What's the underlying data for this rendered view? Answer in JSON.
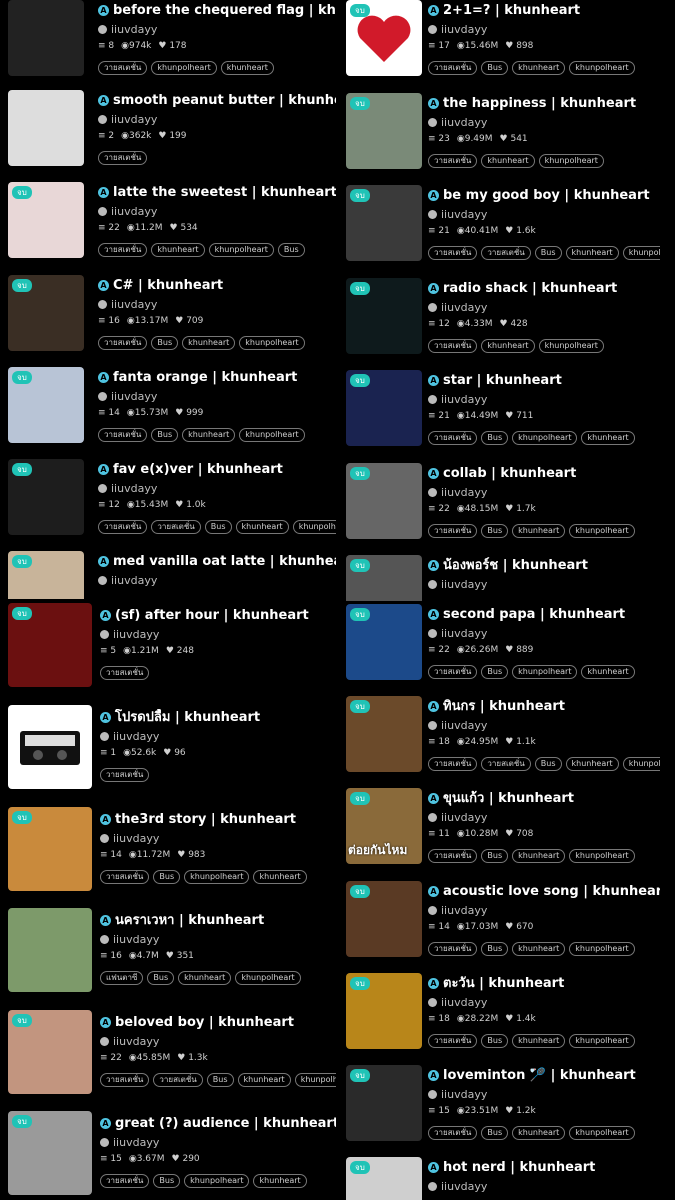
{
  "author": "iiuvdayy",
  "badge": "จบ",
  "cards": [
    {
      "id": "l0",
      "title": "before the chequered flag | khunheart",
      "stats": {
        "parts": "8",
        "reads": "974k",
        "votes": "178"
      },
      "tags": [
        "วายสเตชั่น",
        "khunpolheart",
        "khunheart"
      ],
      "thumb_color": "#222",
      "badge": false
    },
    {
      "id": "l1",
      "title": "smooth peanut butter | khunheart",
      "stats": {
        "parts": "2",
        "reads": "362k",
        "votes": "199"
      },
      "tags": [
        "วายสเตชั่น"
      ],
      "thumb_color": "#ddd",
      "badge": false
    },
    {
      "id": "l2",
      "title": "latte the sweetest | khunheart",
      "stats": {
        "parts": "22",
        "reads": "11.2M",
        "votes": "534"
      },
      "tags": [
        "วายสเตชั่น",
        "khunheart",
        "khunpolheart",
        "Bus"
      ],
      "thumb_color": "#e8d7d7",
      "badge": true
    },
    {
      "id": "l3",
      "title": "C# | khunheart",
      "stats": {
        "parts": "16",
        "reads": "13.17M",
        "votes": "709"
      },
      "tags": [
        "วายสเตชั่น",
        "Bus",
        "khunheart",
        "khunpolheart"
      ],
      "thumb_color": "#3a2e24",
      "badge": true
    },
    {
      "id": "l4",
      "title": "fanta orange | khunheart",
      "stats": {
        "parts": "14",
        "reads": "15.73M",
        "votes": "999"
      },
      "tags": [
        "วายสเตชั่น",
        "Bus",
        "khunheart",
        "khunpolheart"
      ],
      "thumb_color": "#b8c4d6",
      "badge": true
    },
    {
      "id": "l5",
      "title": "fav e(x)ver | khunheart",
      "stats": {
        "parts": "12",
        "reads": "15.43M",
        "votes": "1.0k"
      },
      "tags": [
        "วายสเตชั่น",
        "วายสเตชั่น",
        "Bus",
        "khunheart",
        "khunpolheart"
      ],
      "thumb_color": "#1d1d1d",
      "badge": true
    },
    {
      "id": "l6",
      "title": "med vanilla oat latte | khunheart",
      "stats": {
        "parts": "",
        "reads": "",
        "votes": ""
      },
      "tags": [],
      "thumb_color": "#c8b49a",
      "badge": true
    },
    {
      "id": "l7",
      "title": "(sf) after hour | khunheart",
      "stats": {
        "parts": "5",
        "reads": "1.21M",
        "votes": "248"
      },
      "tags": [
        "วายสเตชั่น"
      ],
      "thumb_color": "#6b1010",
      "badge": true
    },
    {
      "id": "l8",
      "title": "โปรดปลื้ม | khunheart",
      "stats": {
        "parts": "1",
        "reads": "52.6k",
        "votes": "96"
      },
      "tags": [
        "วายสเตชั่น"
      ],
      "thumb_color": "#fff",
      "badge": false
    },
    {
      "id": "l9",
      "title": "the3rd story | khunheart",
      "stats": {
        "parts": "14",
        "reads": "11.72M",
        "votes": "983"
      },
      "tags": [
        "วายสเตชั่น",
        "Bus",
        "khunpolheart",
        "khunheart"
      ],
      "thumb_color": "#c98a3c",
      "badge": true
    },
    {
      "id": "l10",
      "title": "นคราเวหา | khunheart",
      "stats": {
        "parts": "16",
        "reads": "4.7M",
        "votes": "351"
      },
      "tags": [
        "แฟนตาซี",
        "Bus",
        "khunheart",
        "khunpolheart"
      ],
      "thumb_color": "#7d9a6a",
      "badge": false
    },
    {
      "id": "l11",
      "title": "beloved boy | khunheart",
      "stats": {
        "parts": "22",
        "reads": "45.85M",
        "votes": "1.3k"
      },
      "tags": [
        "วายสเตชั่น",
        "วายสเตชั่น",
        "Bus",
        "khunheart",
        "khunpolheart"
      ],
      "thumb_color": "#c2957f",
      "badge": true
    },
    {
      "id": "l12",
      "title": "great (?) audience | khunheart",
      "stats": {
        "parts": "15",
        "reads": "3.67M",
        "votes": "290"
      },
      "tags": [
        "วายสเตชั่น",
        "Bus",
        "khunpolheart",
        "khunheart"
      ],
      "thumb_color": "#9a9a9a",
      "badge": true
    },
    {
      "id": "r0",
      "title": "2+1=? | khunheart",
      "stats": {
        "parts": "17",
        "reads": "15.46M",
        "votes": "898"
      },
      "tags": [
        "วายสเตชั่น",
        "Bus",
        "khunheart",
        "khunpolheart"
      ],
      "thumb_color": "#fff",
      "badge": true
    },
    {
      "id": "r1",
      "title": "the happiness | khunheart",
      "stats": {
        "parts": "23",
        "reads": "9.49M",
        "votes": "541"
      },
      "tags": [
        "วายสเตชั่น",
        "khunheart",
        "khunpolheart"
      ],
      "thumb_color": "#7a8a78",
      "badge": true
    },
    {
      "id": "r2",
      "title": "be my good boy | khunheart",
      "stats": {
        "parts": "21",
        "reads": "40.41M",
        "votes": "1.6k"
      },
      "tags": [
        "วายสเตชั่น",
        "วายสเตชั่น",
        "Bus",
        "khunheart",
        "khunpolheart"
      ],
      "thumb_color": "#3a3a3a",
      "badge": true
    },
    {
      "id": "r3",
      "title": "radio shack | khunheart",
      "stats": {
        "parts": "12",
        "reads": "4.33M",
        "votes": "428"
      },
      "tags": [
        "วายสเตชั่น",
        "khunheart",
        "khunpolheart"
      ],
      "thumb_color": "#0e1a1c",
      "badge": true
    },
    {
      "id": "r4",
      "title": "star | khunheart",
      "stats": {
        "parts": "21",
        "reads": "14.49M",
        "votes": "711"
      },
      "tags": [
        "วายสเตชั่น",
        "Bus",
        "khunpolheart",
        "khunheart"
      ],
      "thumb_color": "#1a2350",
      "badge": true
    },
    {
      "id": "r5",
      "title": "collab | khunheart",
      "stats": {
        "parts": "22",
        "reads": "48.15M",
        "votes": "1.7k"
      },
      "tags": [
        "วายสเตชั่น",
        "Bus",
        "khunheart",
        "khunpolheart"
      ],
      "thumb_color": "#666",
      "badge": true
    },
    {
      "id": "r6",
      "title": "น้องพอร์ช | khunheart",
      "stats": {
        "parts": "",
        "reads": "",
        "votes": ""
      },
      "tags": [],
      "thumb_color": "#555",
      "badge": true
    },
    {
      "id": "r7",
      "title": "second papa | khunheart",
      "stats": {
        "parts": "22",
        "reads": "26.26M",
        "votes": "889"
      },
      "tags": [
        "วายสเตชั่น",
        "Bus",
        "khunpolheart",
        "khunheart"
      ],
      "thumb_color": "#1c4a8a",
      "badge": true
    },
    {
      "id": "r8",
      "title": "ทินกร | khunheart",
      "stats": {
        "parts": "18",
        "reads": "24.95M",
        "votes": "1.1k"
      },
      "tags": [
        "วายสเตชั่น",
        "วายสเตชั่น",
        "Bus",
        "khunheart",
        "khunpolheart"
      ],
      "thumb_color": "#6b4a2a",
      "badge": true
    },
    {
      "id": "r9",
      "title": "ขุนแก้ว | khunheart",
      "stats": {
        "parts": "11",
        "reads": "10.28M",
        "votes": "708"
      },
      "tags": [
        "วายสเตชั่น",
        "Bus",
        "khunheart",
        "khunpolheart"
      ],
      "thumb_color": "#8a6a3a",
      "badge": true,
      "thumb_caption": "ต่อยกันไหม"
    },
    {
      "id": "r10",
      "title": "acoustic love song | khunheart",
      "stats": {
        "parts": "14",
        "reads": "17.03M",
        "votes": "670"
      },
      "tags": [
        "วายสเตชั่น",
        "Bus",
        "khunheart",
        "khunpolheart"
      ],
      "thumb_color": "#5a3a24",
      "badge": true
    },
    {
      "id": "r11",
      "title": "ตะวัน | khunheart",
      "stats": {
        "parts": "18",
        "reads": "28.22M",
        "votes": "1.4k"
      },
      "tags": [
        "วายสเตชั่น",
        "Bus",
        "khunheart",
        "khunpolheart"
      ],
      "thumb_color": "#b8861a",
      "badge": true
    },
    {
      "id": "r12",
      "title": "loveminton 🏸 | khunheart",
      "stats": {
        "parts": "15",
        "reads": "23.51M",
        "votes": "1.2k"
      },
      "tags": [
        "วายสเตชั่น",
        "Bus",
        "khunheart",
        "khunpolheart"
      ],
      "thumb_color": "#2a2a2a",
      "badge": true
    },
    {
      "id": "r13",
      "title": "hot nerd | khunheart",
      "stats": {
        "parts": "",
        "reads": "",
        "votes": ""
      },
      "tags": [],
      "thumb_color": "#cfcfcf",
      "badge": true
    }
  ]
}
